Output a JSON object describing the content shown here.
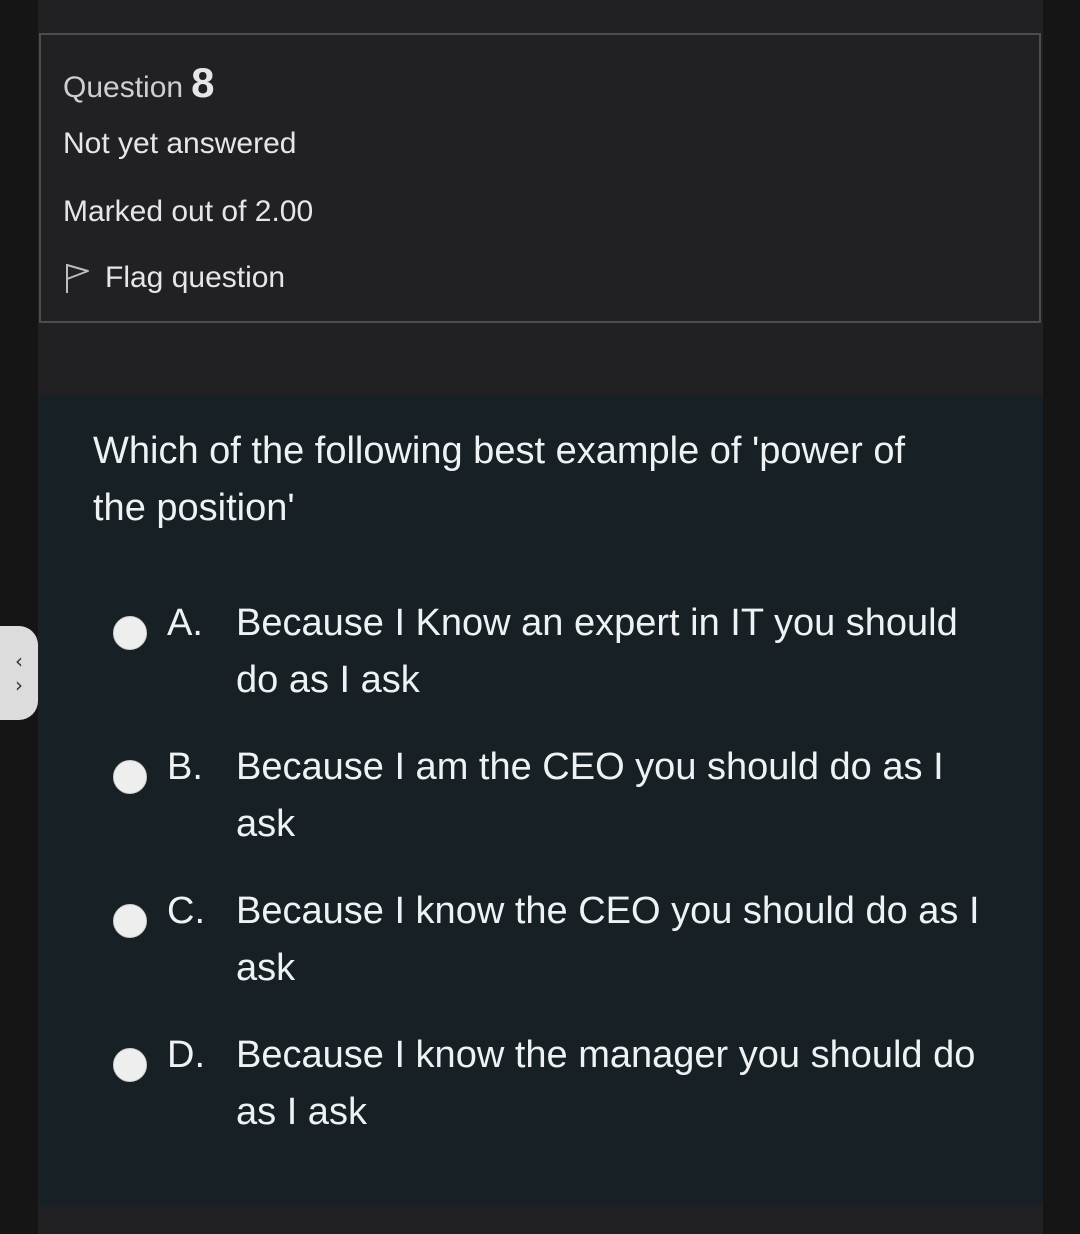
{
  "question": {
    "label": "Question",
    "number": "8",
    "status": "Not yet answered",
    "marks": "Marked out of 2.00",
    "flag_label": "Flag question"
  },
  "prompt": "Which of the following best example of 'power of the position'",
  "answers": [
    {
      "letter": "A.",
      "text": "Because I Know an expert in IT you should do as I ask"
    },
    {
      "letter": "B.",
      "text": "Because I am the CEO you should do as I ask"
    },
    {
      "letter": "C.",
      "text": "Because I know the CEO you should do as I ask"
    },
    {
      "letter": "D.",
      "text": "Because I know the manager you should do as I ask"
    }
  ],
  "nav": {
    "up_icon": "chevron-up-icon",
    "down_icon": "chevron-down-icon"
  },
  "colors": {
    "background": "#212123",
    "content": "#172024",
    "text": "#eef2f3"
  }
}
